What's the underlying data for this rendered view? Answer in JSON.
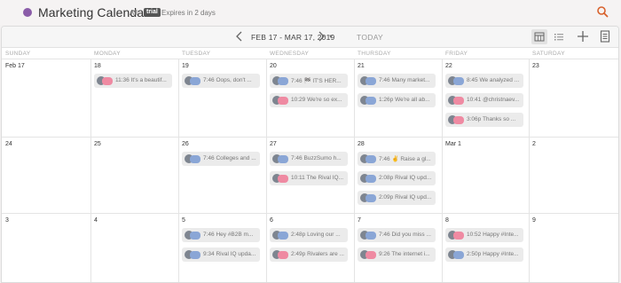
{
  "header": {
    "title": "Marketing Calendar",
    "filter": "All",
    "trial_badge": "trial",
    "expires": "Expires in 2 days"
  },
  "toolbar": {
    "range": "FEB 17 - MAR 17, 2019",
    "today": "TODAY"
  },
  "colors": {
    "accent": "#8a5ca8",
    "twitter": "#8aa6d6",
    "instagram": "#ef8aa2",
    "search": "#d8612c"
  },
  "day_names": [
    "SUNDAY",
    "MONDAY",
    "TUESDAY",
    "WEDNESDAY",
    "THURSDAY",
    "FRIDAY",
    "SATURDAY"
  ],
  "weeks": [
    {
      "days": [
        {
          "date": "Feb 17",
          "posts": []
        },
        {
          "date": "18",
          "posts": [
            {
              "type": "instagram",
              "text": "11:36  It's a beautif..."
            }
          ]
        },
        {
          "date": "19",
          "posts": [
            {
              "type": "twitter",
              "text": "7:46  Oops, don't ..."
            }
          ]
        },
        {
          "date": "20",
          "posts": [
            {
              "type": "twitter",
              "text": "7:46  🏁  IT'S HER..."
            },
            {
              "type": "instagram",
              "text": "10:29  We're so ex..."
            }
          ]
        },
        {
          "date": "21",
          "posts": [
            {
              "type": "twitter",
              "text": "7:46  Many market..."
            },
            {
              "type": "twitter",
              "text": "1:26p  We're all ab..."
            }
          ]
        },
        {
          "date": "22",
          "posts": [
            {
              "type": "twitter",
              "text": "8:45  We analyzed ..."
            },
            {
              "type": "instagram",
              "text": "10:41  @christnaev..."
            },
            {
              "type": "instagram",
              "text": "3:06p  Thanks so ..."
            }
          ]
        },
        {
          "date": "23",
          "posts": []
        }
      ]
    },
    {
      "days": [
        {
          "date": "24",
          "posts": []
        },
        {
          "date": "25",
          "posts": []
        },
        {
          "date": "26",
          "posts": [
            {
              "type": "twitter",
              "text": "7:46  Colleges and ..."
            }
          ]
        },
        {
          "date": "27",
          "posts": [
            {
              "type": "twitter",
              "text": "7:46  BuzzSumo h..."
            },
            {
              "type": "instagram",
              "text": "10:11  The Rival IQ..."
            }
          ]
        },
        {
          "date": "28",
          "posts": [
            {
              "type": "twitter",
              "text": "7:46  ✌  Raise a gl..."
            },
            {
              "type": "twitter",
              "text": "2:08p  Rival IQ upd..."
            },
            {
              "type": "twitter",
              "text": "2:09p  Rival IQ upd..."
            }
          ]
        },
        {
          "date": "Mar 1",
          "posts": []
        },
        {
          "date": "2",
          "posts": []
        }
      ]
    },
    {
      "days": [
        {
          "date": "3",
          "posts": []
        },
        {
          "date": "4",
          "posts": []
        },
        {
          "date": "5",
          "posts": [
            {
              "type": "twitter",
              "text": "7:46  Hey #B2B m..."
            },
            {
              "type": "twitter",
              "text": "9:34  Rival IQ upda..."
            }
          ]
        },
        {
          "date": "6",
          "posts": [
            {
              "type": "twitter",
              "text": "2:48p  Loving our ..."
            },
            {
              "type": "instagram",
              "text": "2:49p  Rivalers are ..."
            }
          ]
        },
        {
          "date": "7",
          "posts": [
            {
              "type": "twitter",
              "text": "7:46  Did you miss ..."
            },
            {
              "type": "instagram",
              "text": "9:26  The internet i..."
            }
          ]
        },
        {
          "date": "8",
          "posts": [
            {
              "type": "instagram",
              "text": "10:52  Happy #Inte..."
            },
            {
              "type": "twitter",
              "text": "2:50p  Happy #Inte..."
            }
          ]
        },
        {
          "date": "9",
          "posts": []
        }
      ]
    }
  ]
}
